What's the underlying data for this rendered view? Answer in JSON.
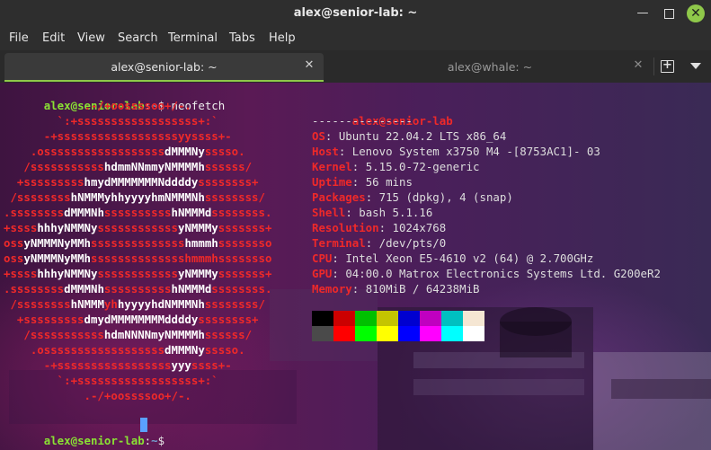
{
  "window": {
    "title": "alex@senior-lab: ~"
  },
  "menu": [
    "File",
    "Edit",
    "View",
    "Search",
    "Terminal",
    "Tabs",
    "Help"
  ],
  "tabs": [
    {
      "label": "alex@senior-lab: ~",
      "active": true
    },
    {
      "label": "alex@whale: ~",
      "active": false
    }
  ],
  "prompt": {
    "user_host": "alex@senior-lab",
    "path": "~",
    "symbol": "$",
    "command": "neofetch"
  },
  "logo_lines": [
    [
      [
        "            .-/+oossssoo+/-.",
        "r"
      ]
    ],
    [
      [
        "        `:+ssssssssssssssssss+:`",
        "r"
      ]
    ],
    [
      [
        "      -+ssssssssssssssssssyyssss+-",
        "r"
      ]
    ],
    [
      [
        "    .ossssssssssssssssss",
        "r"
      ],
      [
        "dMMMNy",
        "w"
      ],
      [
        "sssso.",
        "r"
      ]
    ],
    [
      [
        "   /sssssssssss",
        "r"
      ],
      [
        "hdmmNNmmyNMMMMh",
        "w"
      ],
      [
        "ssssss/",
        "r"
      ]
    ],
    [
      [
        "  +sssssssss",
        "r"
      ],
      [
        "hmydMMMMMMMNddddy",
        "w"
      ],
      [
        "ssssssss+",
        "r"
      ]
    ],
    [
      [
        " /ssssssss",
        "r"
      ],
      [
        "hNMMMyhhyyyyhmNMMMNh",
        "w"
      ],
      [
        "ssssssss/",
        "r"
      ]
    ],
    [
      [
        ".ssssssss",
        "r"
      ],
      [
        "dMMMNh",
        "w"
      ],
      [
        "ssssssssss",
        "r"
      ],
      [
        "hNMMMd",
        "w"
      ],
      [
        "ssssssss.",
        "r"
      ]
    ],
    [
      [
        "+ssss",
        "r"
      ],
      [
        "hhhyNMMNy",
        "w"
      ],
      [
        "ssssssssssss",
        "r"
      ],
      [
        "yNMMMy",
        "w"
      ],
      [
        "sssssss+",
        "r"
      ]
    ],
    [
      [
        "oss",
        "r"
      ],
      [
        "yNMMMNyMMh",
        "w"
      ],
      [
        "ssssssssssssss",
        "r"
      ],
      [
        "hmmmh",
        "w"
      ],
      [
        "ssssssso",
        "r"
      ]
    ],
    [
      [
        "oss",
        "r"
      ],
      [
        "yNMMMNyMMh",
        "w"
      ],
      [
        "sssssssssssssshmmmhssssssso",
        "r"
      ]
    ],
    [
      [
        "+ssss",
        "r"
      ],
      [
        "hhhyNMMNy",
        "w"
      ],
      [
        "ssssssssssss",
        "r"
      ],
      [
        "yNMMMy",
        "w"
      ],
      [
        "sssssss+",
        "r"
      ]
    ],
    [
      [
        ".ssssssss",
        "r"
      ],
      [
        "dMMMNh",
        "w"
      ],
      [
        "ssssssssss",
        "r"
      ],
      [
        "hNMMMd",
        "w"
      ],
      [
        "ssssssss.",
        "r"
      ]
    ],
    [
      [
        " /ssssssss",
        "r"
      ],
      [
        "hNMMM",
        "w"
      ],
      [
        "yh",
        "r"
      ],
      [
        "hyyyyhdNMMMNh",
        "w"
      ],
      [
        "ssssssss/",
        "r"
      ]
    ],
    [
      [
        "  +sssssssss",
        "r"
      ],
      [
        "dmydMMMMMMMMddddy",
        "w"
      ],
      [
        "ssssssss+",
        "r"
      ]
    ],
    [
      [
        "   /sssssssssss",
        "r"
      ],
      [
        "hdmNNNNmyNMMMMh",
        "w"
      ],
      [
        "ssssss/",
        "r"
      ]
    ],
    [
      [
        "    .ossssssssssssssssss",
        "r"
      ],
      [
        "dMMMNy",
        "w"
      ],
      [
        "sssso.",
        "r"
      ]
    ],
    [
      [
        "      -+sssssssssssssssss",
        "r"
      ],
      [
        "yyy",
        "w"
      ],
      [
        "ssss+-",
        "r"
      ]
    ],
    [
      [
        "        `:+ssssssssssssssssss+:`",
        "r"
      ]
    ],
    [
      [
        "            .-/+oossssoo+/-.",
        "r"
      ]
    ]
  ],
  "info": {
    "user_host": "alex@senior-lab",
    "separator": "---------------",
    "rows": [
      {
        "label": "OS",
        "value": "Ubuntu 22.04.2 LTS x86_64"
      },
      {
        "label": "Host",
        "value": "Lenovo System x3750 M4 -[8753AC1]- 03"
      },
      {
        "label": "Kernel",
        "value": "5.15.0-72-generic"
      },
      {
        "label": "Uptime",
        "value": "56 mins"
      },
      {
        "label": "Packages",
        "value": "715 (dpkg), 4 (snap)"
      },
      {
        "label": "Shell",
        "value": "bash 5.1.16"
      },
      {
        "label": "Resolution",
        "value": "1024x768"
      },
      {
        "label": "Terminal",
        "value": "/dev/pts/0"
      },
      {
        "label": "CPU",
        "value": "Intel Xeon E5-4610 v2 (64) @ 2.700GHz"
      },
      {
        "label": "GPU",
        "value": "04:00.0 Matrox Electronics Systems Ltd. G200eR2"
      },
      {
        "label": "Memory",
        "value": "810MiB / 64238MiB"
      }
    ]
  },
  "palette": {
    "row1": [
      "#000000",
      "#cc0000",
      "#00c000",
      "#c4c400",
      "#0000d0",
      "#c000c0",
      "#00c0c0",
      "#f5e6d3"
    ],
    "row2": [
      "#4a4a4a",
      "#ff0000",
      "#00ff00",
      "#ffff00",
      "#0000ff",
      "#ff00ff",
      "#00ffff",
      "#ffffff"
    ]
  }
}
